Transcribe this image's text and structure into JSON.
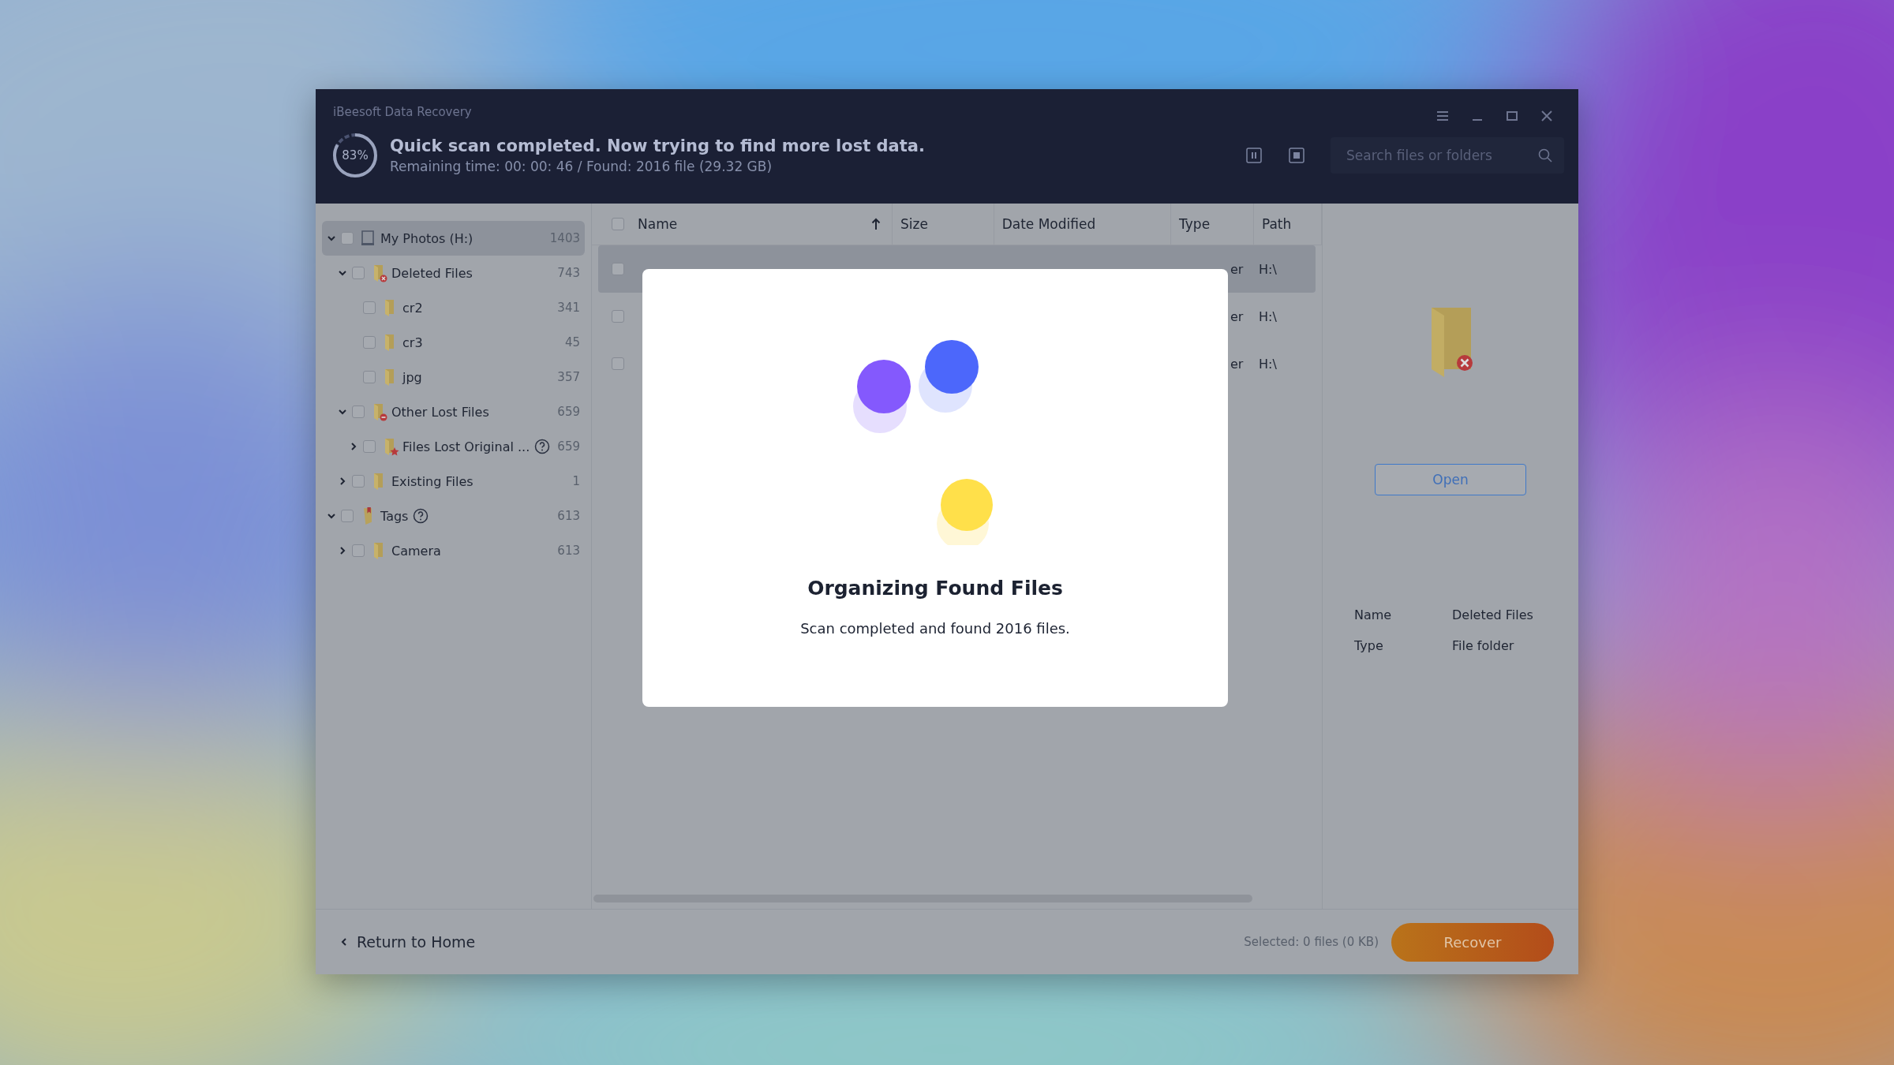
{
  "app_title": "iBeesoft Data Recovery",
  "scan": {
    "level": 0.83,
    "percent": "83%",
    "headline": "Quick scan completed. Now trying to find more lost data.",
    "detail": "Remaining time: 00: 00: 46 / Found: 2016 file (29.32 GB)"
  },
  "search": {
    "placeholder": "Search files or folders"
  },
  "tree": [
    {
      "label": "My Photos (H:)",
      "count": "1403",
      "kind": "drive",
      "expanded": true,
      "checked": false,
      "selected": true,
      "children": [
        {
          "label": "Deleted Files",
          "count": "743",
          "kind": "deleted",
          "expanded": true,
          "checked": false,
          "selected": false,
          "children": [
            {
              "label": "cr2",
              "count": "341",
              "kind": "folder",
              "checked": false,
              "selected": false
            },
            {
              "label": "cr3",
              "count": "45",
              "kind": "folder",
              "checked": false,
              "selected": false
            },
            {
              "label": "jpg",
              "count": "357",
              "kind": "folder",
              "checked": false,
              "selected": false
            }
          ]
        },
        {
          "label": "Other Lost Files",
          "count": "659",
          "kind": "lost",
          "expanded": true,
          "checked": false,
          "selected": false,
          "children": [
            {
              "label": "Files Lost Original ...",
              "count": "659",
              "kind": "star",
              "expanded": false,
              "help": true,
              "checked": false,
              "selected": false
            }
          ]
        },
        {
          "label": "Existing Files",
          "count": "1",
          "kind": "folder",
          "expanded": false,
          "checked": false,
          "selected": false
        }
      ]
    },
    {
      "label": "Tags",
      "count": "613",
      "kind": "tag",
      "expanded": true,
      "help": true,
      "checked": false,
      "selected": false,
      "children": [
        {
          "label": "Camera",
          "count": "613",
          "kind": "folder",
          "expanded": false,
          "checked": false,
          "selected": false
        }
      ]
    }
  ],
  "select_all_checked": false,
  "columns": [
    {
      "label": "Name",
      "sorted": true
    },
    {
      "label": "Size",
      "sorted": false
    },
    {
      "label": "Date Modified",
      "sorted": false
    },
    {
      "label": "Type",
      "sorted": false
    },
    {
      "label": "Path",
      "sorted": false
    }
  ],
  "rows": [
    {
      "type": "er",
      "path": "H:\\",
      "checked": false,
      "selected": true
    },
    {
      "type": "er",
      "path": "H:\\",
      "checked": false,
      "selected": false
    },
    {
      "type": "er",
      "path": "H:\\",
      "checked": false,
      "selected": false
    }
  ],
  "preview": {
    "open": "Open",
    "props": [
      {
        "name": "Name",
        "value": "Deleted Files"
      },
      {
        "name": "Type",
        "value": "File folder"
      }
    ]
  },
  "footer": {
    "back": "Return to Home",
    "selection": "Selected: 0 files (0 KB)",
    "recover": "Recover"
  },
  "dialog": {
    "title": "Organizing Found Files",
    "message": "Scan completed and found 2016 files."
  }
}
